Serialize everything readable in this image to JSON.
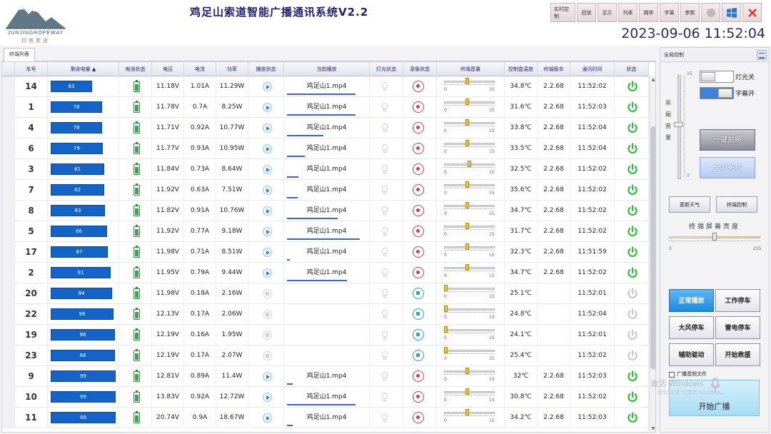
{
  "header": {
    "app_title": "鸡足山索道智能广播通讯系统V2.2",
    "logo_text": "JUNJINGROPEWAY",
    "logo_sub": "钧景索道",
    "datetime": "2023-09-06 11:52:04",
    "toolbar": [
      {
        "label": "实时控制",
        "name": "realtime-control-button"
      },
      {
        "label": "回放",
        "name": "playback-button"
      },
      {
        "label": "显示",
        "name": "display-button"
      },
      {
        "label": "列表",
        "name": "list-button"
      },
      {
        "label": "媒体",
        "name": "media-button"
      },
      {
        "label": "字幕",
        "name": "subtitle-button"
      },
      {
        "label": "参数",
        "name": "params-button"
      }
    ]
  },
  "tabs": {
    "terminals": "终端列表"
  },
  "grid": {
    "columns": [
      "车号",
      "剩余电量",
      "电池状态",
      "电压",
      "电流",
      "功率",
      "播放状态",
      "当前播放",
      "灯光状态",
      "录像状态",
      "终端音量",
      "控制盒温度",
      "终端版本",
      "通讯时间",
      "状态"
    ],
    "volume_min": "0",
    "volume_max": "15",
    "rows": [
      {
        "car": "14",
        "batt": 63,
        "voltage": "11.18V",
        "current": "1.01A",
        "power": "11.29W",
        "playing": true,
        "track": "鸡足山1.mp4",
        "progress": 0.98,
        "rec": "rec",
        "volume": 0.45,
        "temp": "34.8℃",
        "ver": "2.2.68",
        "time": "11:52:02",
        "on": true
      },
      {
        "car": "1",
        "batt": 78,
        "voltage": "11.78V",
        "current": "0.7A",
        "power": "8.25W",
        "playing": true,
        "track": "鸡足山1.mp4",
        "progress": 0.98,
        "rec": "rec",
        "volume": 0.45,
        "temp": "31.6℃",
        "ver": "2.2.68",
        "time": "11:52:03",
        "on": true
      },
      {
        "car": "4",
        "batt": 78,
        "voltage": "11.71V",
        "current": "0.92A",
        "power": "10.77W",
        "playing": true,
        "track": "鸡足山1.mp4",
        "progress": 0.52,
        "rec": "rec",
        "volume": 0.45,
        "temp": "33.8℃",
        "ver": "2.2.68",
        "time": "11:52:04",
        "on": true
      },
      {
        "car": "6",
        "batt": 79,
        "voltage": "11.77V",
        "current": "0.93A",
        "power": "10.95W",
        "playing": true,
        "track": "鸡足山1.mp4",
        "progress": 0.26,
        "rec": "rec",
        "volume": 0.45,
        "temp": "33.5℃",
        "ver": "2.2.68",
        "time": "11:52:04",
        "on": true
      },
      {
        "car": "3",
        "batt": 81,
        "voltage": "11.84V",
        "current": "0.73A",
        "power": "8.64W",
        "playing": true,
        "track": "鸡足山1.mp4",
        "progress": 0.16,
        "rec": "rec",
        "volume": 0.5,
        "temp": "32.5℃",
        "ver": "2.2.68",
        "time": "11:52:02",
        "on": true
      },
      {
        "car": "7",
        "batt": 82,
        "voltage": "11.92V",
        "current": "0.63A",
        "power": "7.51W",
        "playing": true,
        "track": "鸡足山1.mp4",
        "progress": 0.15,
        "rec": "rec",
        "volume": 0.45,
        "temp": "35.6℃",
        "ver": "2.2.68",
        "time": "11:52:02",
        "on": true
      },
      {
        "car": "8",
        "batt": 83,
        "voltage": "11.82V",
        "current": "0.91A",
        "power": "10.76W",
        "playing": true,
        "track": "鸡足山1.mp4",
        "progress": 0.72,
        "rec": "rec",
        "volume": 0.45,
        "temp": "34.7℃",
        "ver": "2.2.68",
        "time": "11:52:02",
        "on": true
      },
      {
        "car": "5",
        "batt": 86,
        "voltage": "11.92V",
        "current": "0.77A",
        "power": "9.18W",
        "playing": true,
        "track": "鸡足山1.mp4",
        "progress": 1.04,
        "rec": "rec",
        "volume": 0.45,
        "temp": "31.7℃",
        "ver": "2.2.68",
        "time": "11:52:02",
        "on": true
      },
      {
        "car": "17",
        "batt": 87,
        "voltage": "11.98V",
        "current": "0.71A",
        "power": "8.51W",
        "playing": true,
        "track": "鸡足山1.mp4",
        "progress": 0.04,
        "rec": "rec",
        "volume": 0.45,
        "temp": "32.3℃",
        "ver": "2.2.68",
        "time": "11:51:59",
        "on": true
      },
      {
        "car": "2",
        "batt": 91,
        "voltage": "11.95V",
        "current": "0.79A",
        "power": "9.44W",
        "playing": true,
        "track": "鸡足山1.mp4",
        "progress": 0.86,
        "rec": "rec",
        "volume": 0.45,
        "temp": "34.7℃",
        "ver": "2.2.68",
        "time": "11:52:02",
        "on": true
      },
      {
        "car": "20",
        "batt": 94,
        "voltage": "11.98V",
        "current": "0.18A",
        "power": "2.16W",
        "playing": false,
        "track": "",
        "progress": 0,
        "rec": "stop",
        "volume": 0.0,
        "temp": "25.1℃",
        "ver": "",
        "time": "11:52:01",
        "on": false
      },
      {
        "car": "22",
        "batt": 96,
        "voltage": "12.13V",
        "current": "0.17A",
        "power": "2.06W",
        "playing": false,
        "track": "",
        "progress": 0,
        "rec": "stop",
        "volume": 0.0,
        "temp": "24.8℃",
        "ver": "",
        "time": "11:52:04",
        "on": false
      },
      {
        "car": "19",
        "batt": 98,
        "voltage": "12.19V",
        "current": "0.16A",
        "power": "1.95W",
        "playing": false,
        "track": "",
        "progress": 0,
        "rec": "stop",
        "volume": 0.0,
        "temp": "24.1℃",
        "ver": "",
        "time": "11:52:01",
        "on": false
      },
      {
        "car": "23",
        "batt": 98,
        "voltage": "12.19V",
        "current": "0.17A",
        "power": "2.07W",
        "playing": false,
        "track": "",
        "progress": 0,
        "rec": "stop",
        "volume": 0.0,
        "temp": "25.4℃",
        "ver": "",
        "time": "11:52:02",
        "on": false
      },
      {
        "car": "9",
        "batt": 99,
        "voltage": "12.81V",
        "current": "0.89A",
        "power": "11.4W",
        "playing": true,
        "track": "鸡足山1.mp4",
        "progress": 0.08,
        "rec": "rec",
        "volume": 0.45,
        "temp": "32℃",
        "ver": "2.2.68",
        "time": "11:52:03",
        "on": true
      },
      {
        "car": "10",
        "batt": 99,
        "voltage": "13.83V",
        "current": "0.92A",
        "power": "12.72W",
        "playing": true,
        "track": "鸡足山1.mp4",
        "progress": 0.98,
        "rec": "rec",
        "volume": 0.45,
        "temp": "30.8℃",
        "ver": "2.2.68",
        "time": "11:52:02",
        "on": true
      },
      {
        "car": "11",
        "batt": 99,
        "voltage": "20.74V",
        "current": "0.9A",
        "power": "18.67W",
        "playing": true,
        "track": "鸡足山1.mp4",
        "progress": 0.08,
        "rec": "rec",
        "volume": 0.45,
        "temp": "34.2℃",
        "ver": "2.2.68",
        "time": "11:52:03",
        "on": true
      }
    ]
  },
  "panel": {
    "title": "全局控制",
    "master_volume_label": "吊厢音量",
    "master_max": "15",
    "master_min": "0",
    "light_toggle": "灯光关",
    "subtitle_toggle": "字幕开",
    "snapshot_button": "一键拍照",
    "all_off_button": "全部关机",
    "weather_button": "更新天气",
    "terminal_control_button": "终端控制",
    "brightness_label": "终端屏幕亮度",
    "brightness_min": "0",
    "brightness_max": "255",
    "modes": {
      "normal": "正常播放",
      "work_stop": "工作停车",
      "wind_stop": "大风停车",
      "thunder_stop": "雷电停车",
      "aux_drive": "辅助驱动",
      "rescue": "开始救援"
    },
    "bcast_checkbox": "广播音频文件",
    "bcast_button": "开始广播",
    "watermark": "激活 Windows",
    "watermark_sub": "转到\"设置\"以激活 Windows。"
  },
  "colors": {
    "accent": "#1464c8",
    "title": "#1d1e74",
    "active_mode": "#1c8be0",
    "power_on": "#2fbf3a",
    "power_off": "#c8c8c8"
  }
}
